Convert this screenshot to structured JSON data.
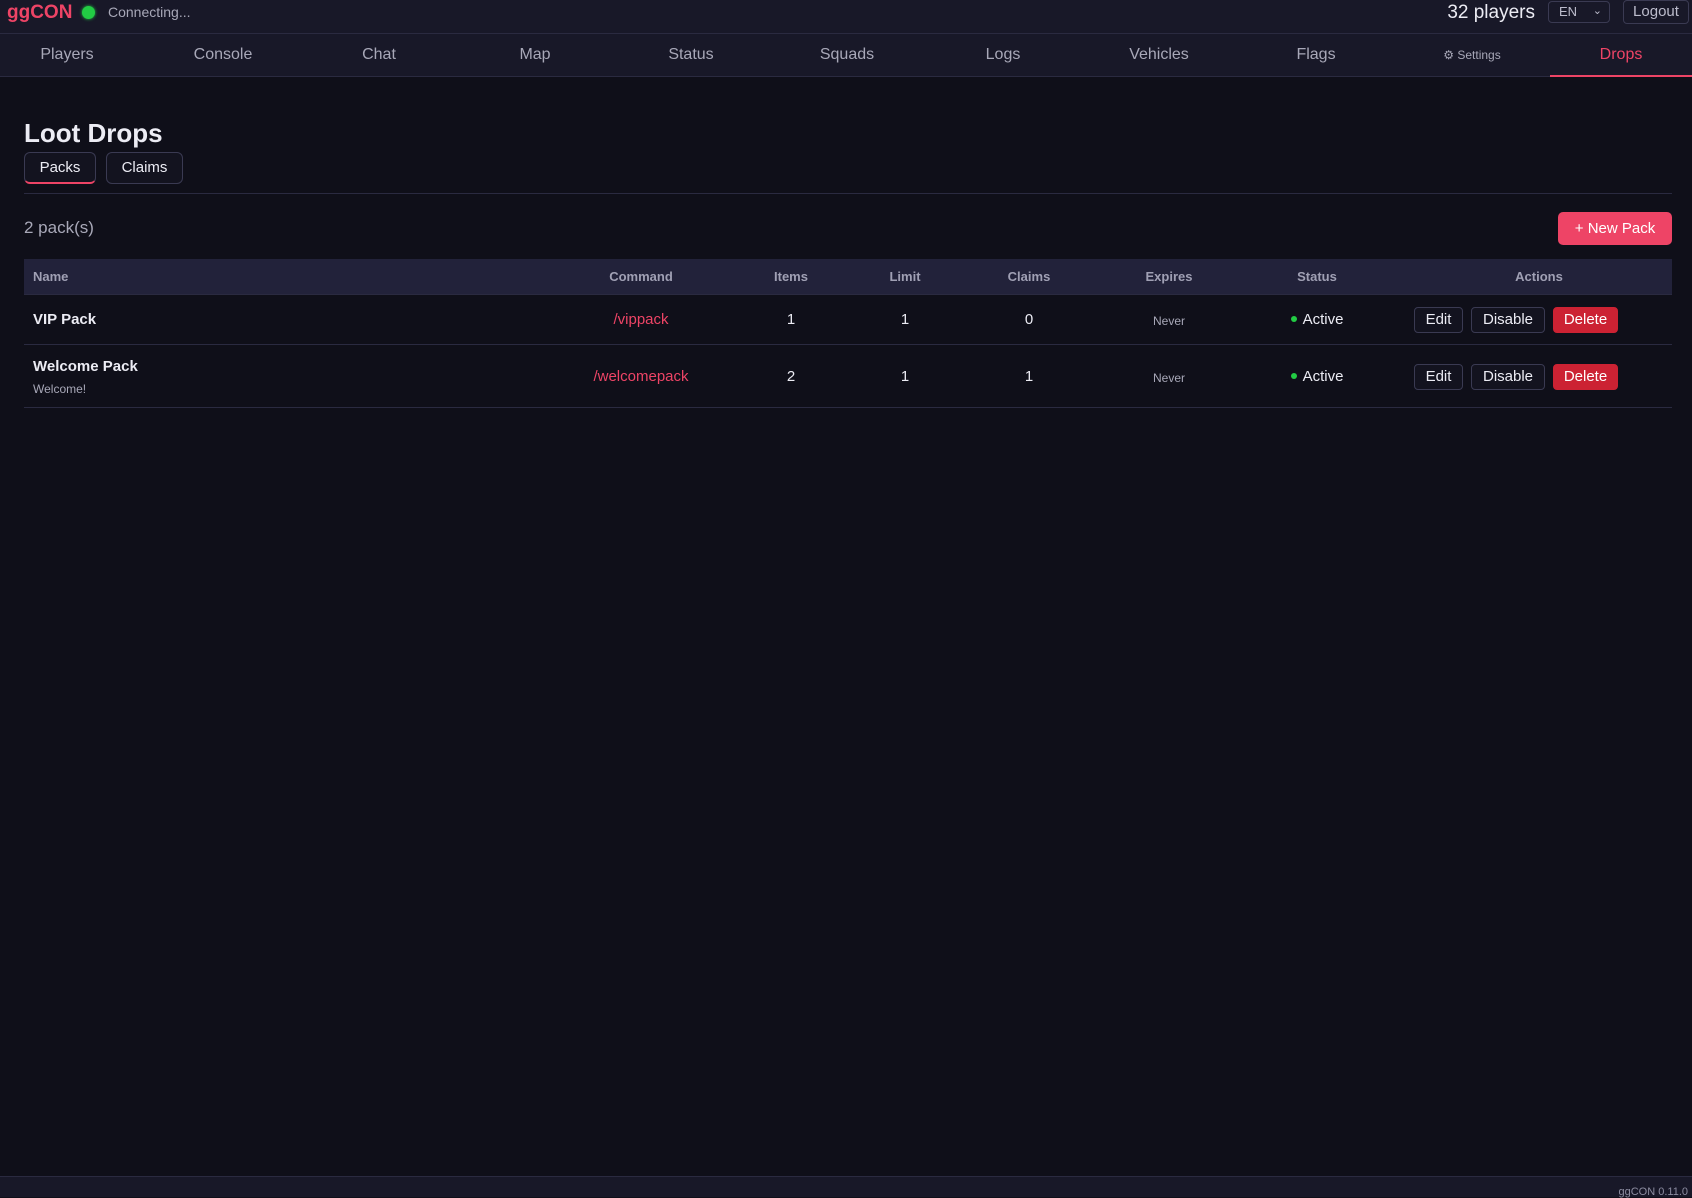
{
  "app": {
    "brand": "ggCON",
    "connection_status": "Connecting...",
    "players_count": "32 players",
    "language": "EN",
    "logout_label": "Logout",
    "version": "ggCON 0.11.0"
  },
  "nav": {
    "items": [
      {
        "label": "Players"
      },
      {
        "label": "Console"
      },
      {
        "label": "Chat"
      },
      {
        "label": "Map"
      },
      {
        "label": "Status"
      },
      {
        "label": "Squads"
      },
      {
        "label": "Logs"
      },
      {
        "label": "Vehicles"
      },
      {
        "label": "Flags"
      },
      {
        "label": "⚙ Settings"
      },
      {
        "label": "Drops"
      }
    ],
    "active": "Drops"
  },
  "page": {
    "title": "Loot Drops",
    "subtabs": [
      {
        "label": "Packs"
      },
      {
        "label": "Claims"
      }
    ],
    "active_subtab": "Packs",
    "pack_count": "2 pack(s)",
    "new_pack_label": "+ New Pack"
  },
  "table": {
    "headers": [
      "Name",
      "Command",
      "Items",
      "Limit",
      "Claims",
      "Expires",
      "Status",
      "Actions"
    ],
    "rows": [
      {
        "name": "VIP Pack",
        "description": "",
        "command": "/vippack",
        "items": "1",
        "limit": "1",
        "claims": "0",
        "expires": "Never",
        "status": "Active",
        "actions": {
          "edit": "Edit",
          "disable": "Disable",
          "delete": "Delete"
        }
      },
      {
        "name": "Welcome Pack",
        "description": "Welcome!",
        "command": "/welcomepack",
        "items": "2",
        "limit": "1",
        "claims": "1",
        "expires": "Never",
        "status": "Active",
        "actions": {
          "edit": "Edit",
          "disable": "Disable",
          "delete": "Delete"
        }
      }
    ]
  },
  "colors": {
    "accent": "#ee4466",
    "background": "#0f0f19",
    "status_active": "#22cc44",
    "danger": "#cc2233"
  }
}
